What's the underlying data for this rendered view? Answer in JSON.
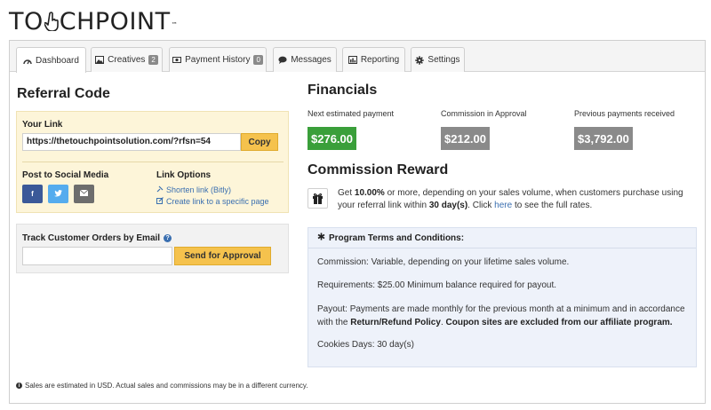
{
  "brand": {
    "logo_pre": "TO",
    "logo_post": "CHPOINT",
    "logo_tm": "™"
  },
  "tabs": [
    {
      "label": "Dashboard",
      "icon": "dashboard-icon"
    },
    {
      "label": "Creatives",
      "icon": "image-icon",
      "badge": "2"
    },
    {
      "label": "Payment History",
      "icon": "money-icon",
      "badge": "0"
    },
    {
      "label": "Messages",
      "icon": "comment-icon"
    },
    {
      "label": "Reporting",
      "icon": "chart-icon"
    },
    {
      "label": "Settings",
      "icon": "gear-icon"
    }
  ],
  "referral": {
    "title": "Referral Code",
    "your_link_label": "Your Link",
    "link_value": "https://thetouchpointsolution.com/?rfsn=54",
    "copy_label": "Copy",
    "post_social_label": "Post to Social Media",
    "social": [
      {
        "name": "facebook",
        "glyph": "f",
        "color": "#3b5998"
      },
      {
        "name": "twitter",
        "glyph": "t",
        "color": "#55acee"
      },
      {
        "name": "email",
        "glyph": "✉",
        "color": "#6d6d6d"
      }
    ],
    "link_options_label": "Link Options",
    "shorten_link": "Shorten link (Bitly)",
    "create_link": "Create link to a specific page"
  },
  "track": {
    "title": "Track Customer Orders by Email",
    "email_value": "",
    "send_label": "Send for Approval"
  },
  "financials": {
    "title": "Financials",
    "items": [
      {
        "label": "Next estimated payment",
        "value": "$276.00",
        "color": "#3a9f3a"
      },
      {
        "label": "Commission in Approval",
        "value": "$212.00",
        "color": "#8a8a8a"
      },
      {
        "label": "Previous payments received",
        "value": "$3,792.00",
        "color": "#8a8a8a"
      }
    ]
  },
  "commission": {
    "title": "Commission Reward",
    "t1": "Get ",
    "pct": "10.00%",
    "t2": " or more, depending on your sales volume, when customers purchase using your referral link within ",
    "days": "30 day(s)",
    "t3": ". Click ",
    "here": "here",
    "t4": " to see the full rates."
  },
  "terms": {
    "title": "Program Terms and Conditions:",
    "commission": "Commission: Variable, depending on your lifetime sales volume.",
    "requirements": "Requirements: $25.00 Minimum balance required for payout.",
    "payout_1": "Payout: Payments are made monthly for the previous month at a minimum and in accordance with the ",
    "payout_policy": "Return/Refund Policy",
    "payout_2": ". ",
    "payout_coupon": "Coupon sites are excluded from our affiliate program.",
    "cookies": "Cookies Days: 30 day(s)"
  },
  "footnote": "Sales are estimated in USD. Actual sales and commissions may be in a different currency.",
  "colors": {
    "accent_yellow": "#f5c24d",
    "link_blue": "#3a6fb0",
    "green": "#3a9f3a"
  }
}
